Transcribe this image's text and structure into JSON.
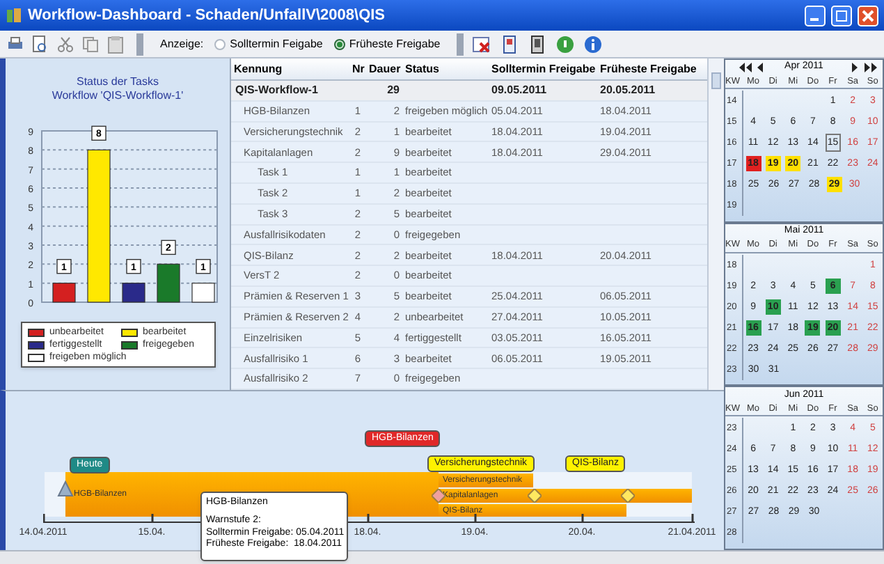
{
  "window": {
    "title": "Workflow-Dashboard - Schaden/UnfallV\\2008\\QIS"
  },
  "toolbar": {
    "label": "Anzeige:",
    "options": [
      {
        "label": "Solltermin Feigabe",
        "selected": false
      },
      {
        "label": "Früheste Freigabe",
        "selected": true
      }
    ]
  },
  "status_chart": {
    "title": "Status der Tasks",
    "subtitle": "Workflow 'QIS-Workflow-1'",
    "chart_data": {
      "type": "bar",
      "series": [
        {
          "name": "unbearbeitet",
          "color": "#d42020",
          "values": [
            1
          ]
        },
        {
          "name": "bearbeitet",
          "color": "#ffe800",
          "values": [
            8
          ]
        },
        {
          "name": "fertiggestellt",
          "color": "#2a2a8a",
          "values": [
            1
          ]
        },
        {
          "name": "freigegeben",
          "color": "#1a7a2a",
          "values": [
            2
          ]
        },
        {
          "name": "freigeben möglich",
          "color": "#ffffff",
          "values": [
            1
          ]
        }
      ],
      "ylim": [
        0,
        9
      ],
      "yticks": [
        0,
        1,
        2,
        3,
        4,
        5,
        6,
        7,
        8,
        9
      ],
      "grid": true,
      "data_labels": true
    }
  },
  "table": {
    "columns": [
      "Kennung",
      "Nr",
      "Dauer",
      "Status",
      "Solltermin Freigabe",
      "Früheste Freigabe"
    ],
    "rows": [
      {
        "kennung": "QIS-Workflow-1",
        "dauer": "29",
        "solltermin": "09.05.2011",
        "frueheste": "20.05.2011",
        "children": [
          {
            "kennung": "HGB-Bilanzen",
            "nr": "1",
            "dauer": "2",
            "status": "freigeben möglich",
            "solltermin": "05.04.2011",
            "frueheste": "18.04.2011"
          },
          {
            "kennung": "Versicherungstechnik",
            "nr": "2",
            "dauer": "1",
            "status": "bearbeitet",
            "solltermin": "18.04.2011",
            "frueheste": "19.04.2011"
          },
          {
            "kennung": "Kapitalanlagen",
            "nr": "2",
            "dauer": "9",
            "status": "bearbeitet",
            "solltermin": "18.04.2011",
            "frueheste": "29.04.2011",
            "children": [
              {
                "kennung": "Task 1",
                "nr": "1",
                "dauer": "1",
                "status": "bearbeitet"
              },
              {
                "kennung": "Task 2",
                "nr": "1",
                "dauer": "2",
                "status": "bearbeitet"
              },
              {
                "kennung": "Task 3",
                "nr": "2",
                "dauer": "5",
                "status": "bearbeitet"
              }
            ]
          },
          {
            "kennung": "Ausfallrisikodaten",
            "nr": "2",
            "dauer": "0",
            "status": "freigegeben"
          },
          {
            "kennung": "QIS-Bilanz",
            "nr": "2",
            "dauer": "2",
            "status": "bearbeitet",
            "solltermin": "18.04.2011",
            "frueheste": "20.04.2011"
          },
          {
            "kennung": "VersT 2",
            "nr": "2",
            "dauer": "0",
            "status": "bearbeitet"
          },
          {
            "kennung": "Prämien & Reserven 1",
            "nr": "3",
            "dauer": "5",
            "status": "bearbeitet",
            "solltermin": "25.04.2011",
            "frueheste": "06.05.2011"
          },
          {
            "kennung": "Prämien & Reserven 2",
            "nr": "4",
            "dauer": "2",
            "status": "unbearbeitet",
            "solltermin": "27.04.2011",
            "frueheste": "10.05.2011"
          },
          {
            "kennung": "Einzelrisiken",
            "nr": "5",
            "dauer": "4",
            "status": "fertiggestellt",
            "solltermin": "03.05.2011",
            "frueheste": "16.05.2011"
          },
          {
            "kennung": "Ausfallrisiko 1",
            "nr": "6",
            "dauer": "3",
            "status": "bearbeitet",
            "solltermin": "06.05.2011",
            "frueheste": "19.05.2011"
          },
          {
            "kennung": "Ausfallrisiko 2",
            "nr": "7",
            "dauer": "0",
            "status": "freigegeben"
          }
        ]
      }
    ]
  },
  "gantt": {
    "callouts": [
      {
        "label": "Heute",
        "color": "#1f8a86"
      },
      {
        "label": "HGB-Bilanzen",
        "color": "#e02828"
      },
      {
        "label": "Versicherungstechnik",
        "color": "#fff200"
      },
      {
        "label": "QIS-Bilanz",
        "color": "#fff200"
      }
    ],
    "bars": [
      {
        "label": "HGB-Bilanzen"
      },
      {
        "label": "Versicherungstechnik"
      },
      {
        "label": "Kapitalanlagen"
      },
      {
        "label": "QIS-Bilanz"
      }
    ],
    "axis_labels": [
      "14.04.2011",
      "15.04.",
      "18.04.",
      "19.04.",
      "20.04.",
      "21.04.2011"
    ],
    "tooltip": {
      "title": "HGB-Bilanzen",
      "lines": [
        "Warnstufe 2:",
        "Solltermin Freigabe: 05.04.2011",
        "Früheste Freigabe:  18.04.2011"
      ]
    }
  },
  "calendar": {
    "months": [
      {
        "title": "Apr 2011",
        "navigation": true,
        "headers": [
          "KW",
          "Mo",
          "Di",
          "Mi",
          "Do",
          "Fr",
          "Sa",
          "So"
        ],
        "weeks": [
          {
            "kw": "14",
            "days": [
              "1",
              "2",
              "3"
            ]
          },
          {
            "kw": "15",
            "days": [
              "4",
              "5",
              "6",
              "7",
              "8",
              "9",
              "10"
            ]
          },
          {
            "kw": "16",
            "days": [
              "11",
              "12",
              "13",
              "14",
              {
                "d": "15",
                "today": true
              },
              "16",
              "17"
            ]
          },
          {
            "kw": "17",
            "days": [
              {
                "d": "18",
                "color": "#e02020"
              },
              {
                "d": "19",
                "color": "#ffe000"
              },
              {
                "d": "20",
                "color": "#ffe000"
              },
              "21",
              "22",
              "23",
              "24"
            ]
          },
          {
            "kw": "18",
            "days": [
              "25",
              "26",
              "27",
              "28",
              {
                "d": "29",
                "color": "#ffe000"
              },
              "30"
            ]
          },
          {
            "kw": "19"
          }
        ]
      },
      {
        "title": "Mai 2011",
        "navigation": false,
        "headers": [
          "KW",
          "Mo",
          "Di",
          "Mi",
          "Do",
          "Fr",
          "Sa",
          "So"
        ],
        "weeks": [
          {
            "kw": "18",
            "days": [
              "1"
            ]
          },
          {
            "kw": "19",
            "days": [
              "2",
              "3",
              "4",
              "5",
              {
                "d": "6",
                "color": "#2aa050"
              },
              "7",
              "8"
            ]
          },
          {
            "kw": "20",
            "days": [
              "9",
              {
                "d": "10",
                "color": "#2aa050"
              },
              "11",
              "12",
              "13",
              "14",
              "15"
            ]
          },
          {
            "kw": "21",
            "days": [
              {
                "d": "16",
                "color": "#2aa050"
              },
              "17",
              "18",
              {
                "d": "19",
                "color": "#2aa050"
              },
              {
                "d": "20",
                "color": "#2aa050"
              },
              "21",
              "22"
            ]
          },
          {
            "kw": "22",
            "days": [
              "23",
              "24",
              "25",
              "26",
              "27",
              "28",
              "29"
            ]
          },
          {
            "kw": "23",
            "days": [
              "30",
              "31"
            ]
          }
        ]
      },
      {
        "title": "Jun 2011",
        "navigation": false,
        "headers": [
          "KW",
          "Mo",
          "Di",
          "Mi",
          "Do",
          "Fr",
          "Sa",
          "So"
        ],
        "weeks": [
          {
            "kw": "23",
            "days": [
              "1",
              "2",
              "3",
              "4",
              "5"
            ]
          },
          {
            "kw": "24",
            "days": [
              "6",
              "7",
              "8",
              "9",
              "10",
              "11",
              "12"
            ]
          },
          {
            "kw": "25",
            "days": [
              "13",
              "14",
              "15",
              "16",
              "17",
              "18",
              "19"
            ]
          },
          {
            "kw": "26",
            "days": [
              "20",
              "21",
              "22",
              "23",
              "24",
              "25",
              "26"
            ]
          },
          {
            "kw": "27",
            "days": [
              "27",
              "28",
              "29",
              "30"
            ]
          },
          {
            "kw": "28"
          }
        ]
      }
    ]
  }
}
